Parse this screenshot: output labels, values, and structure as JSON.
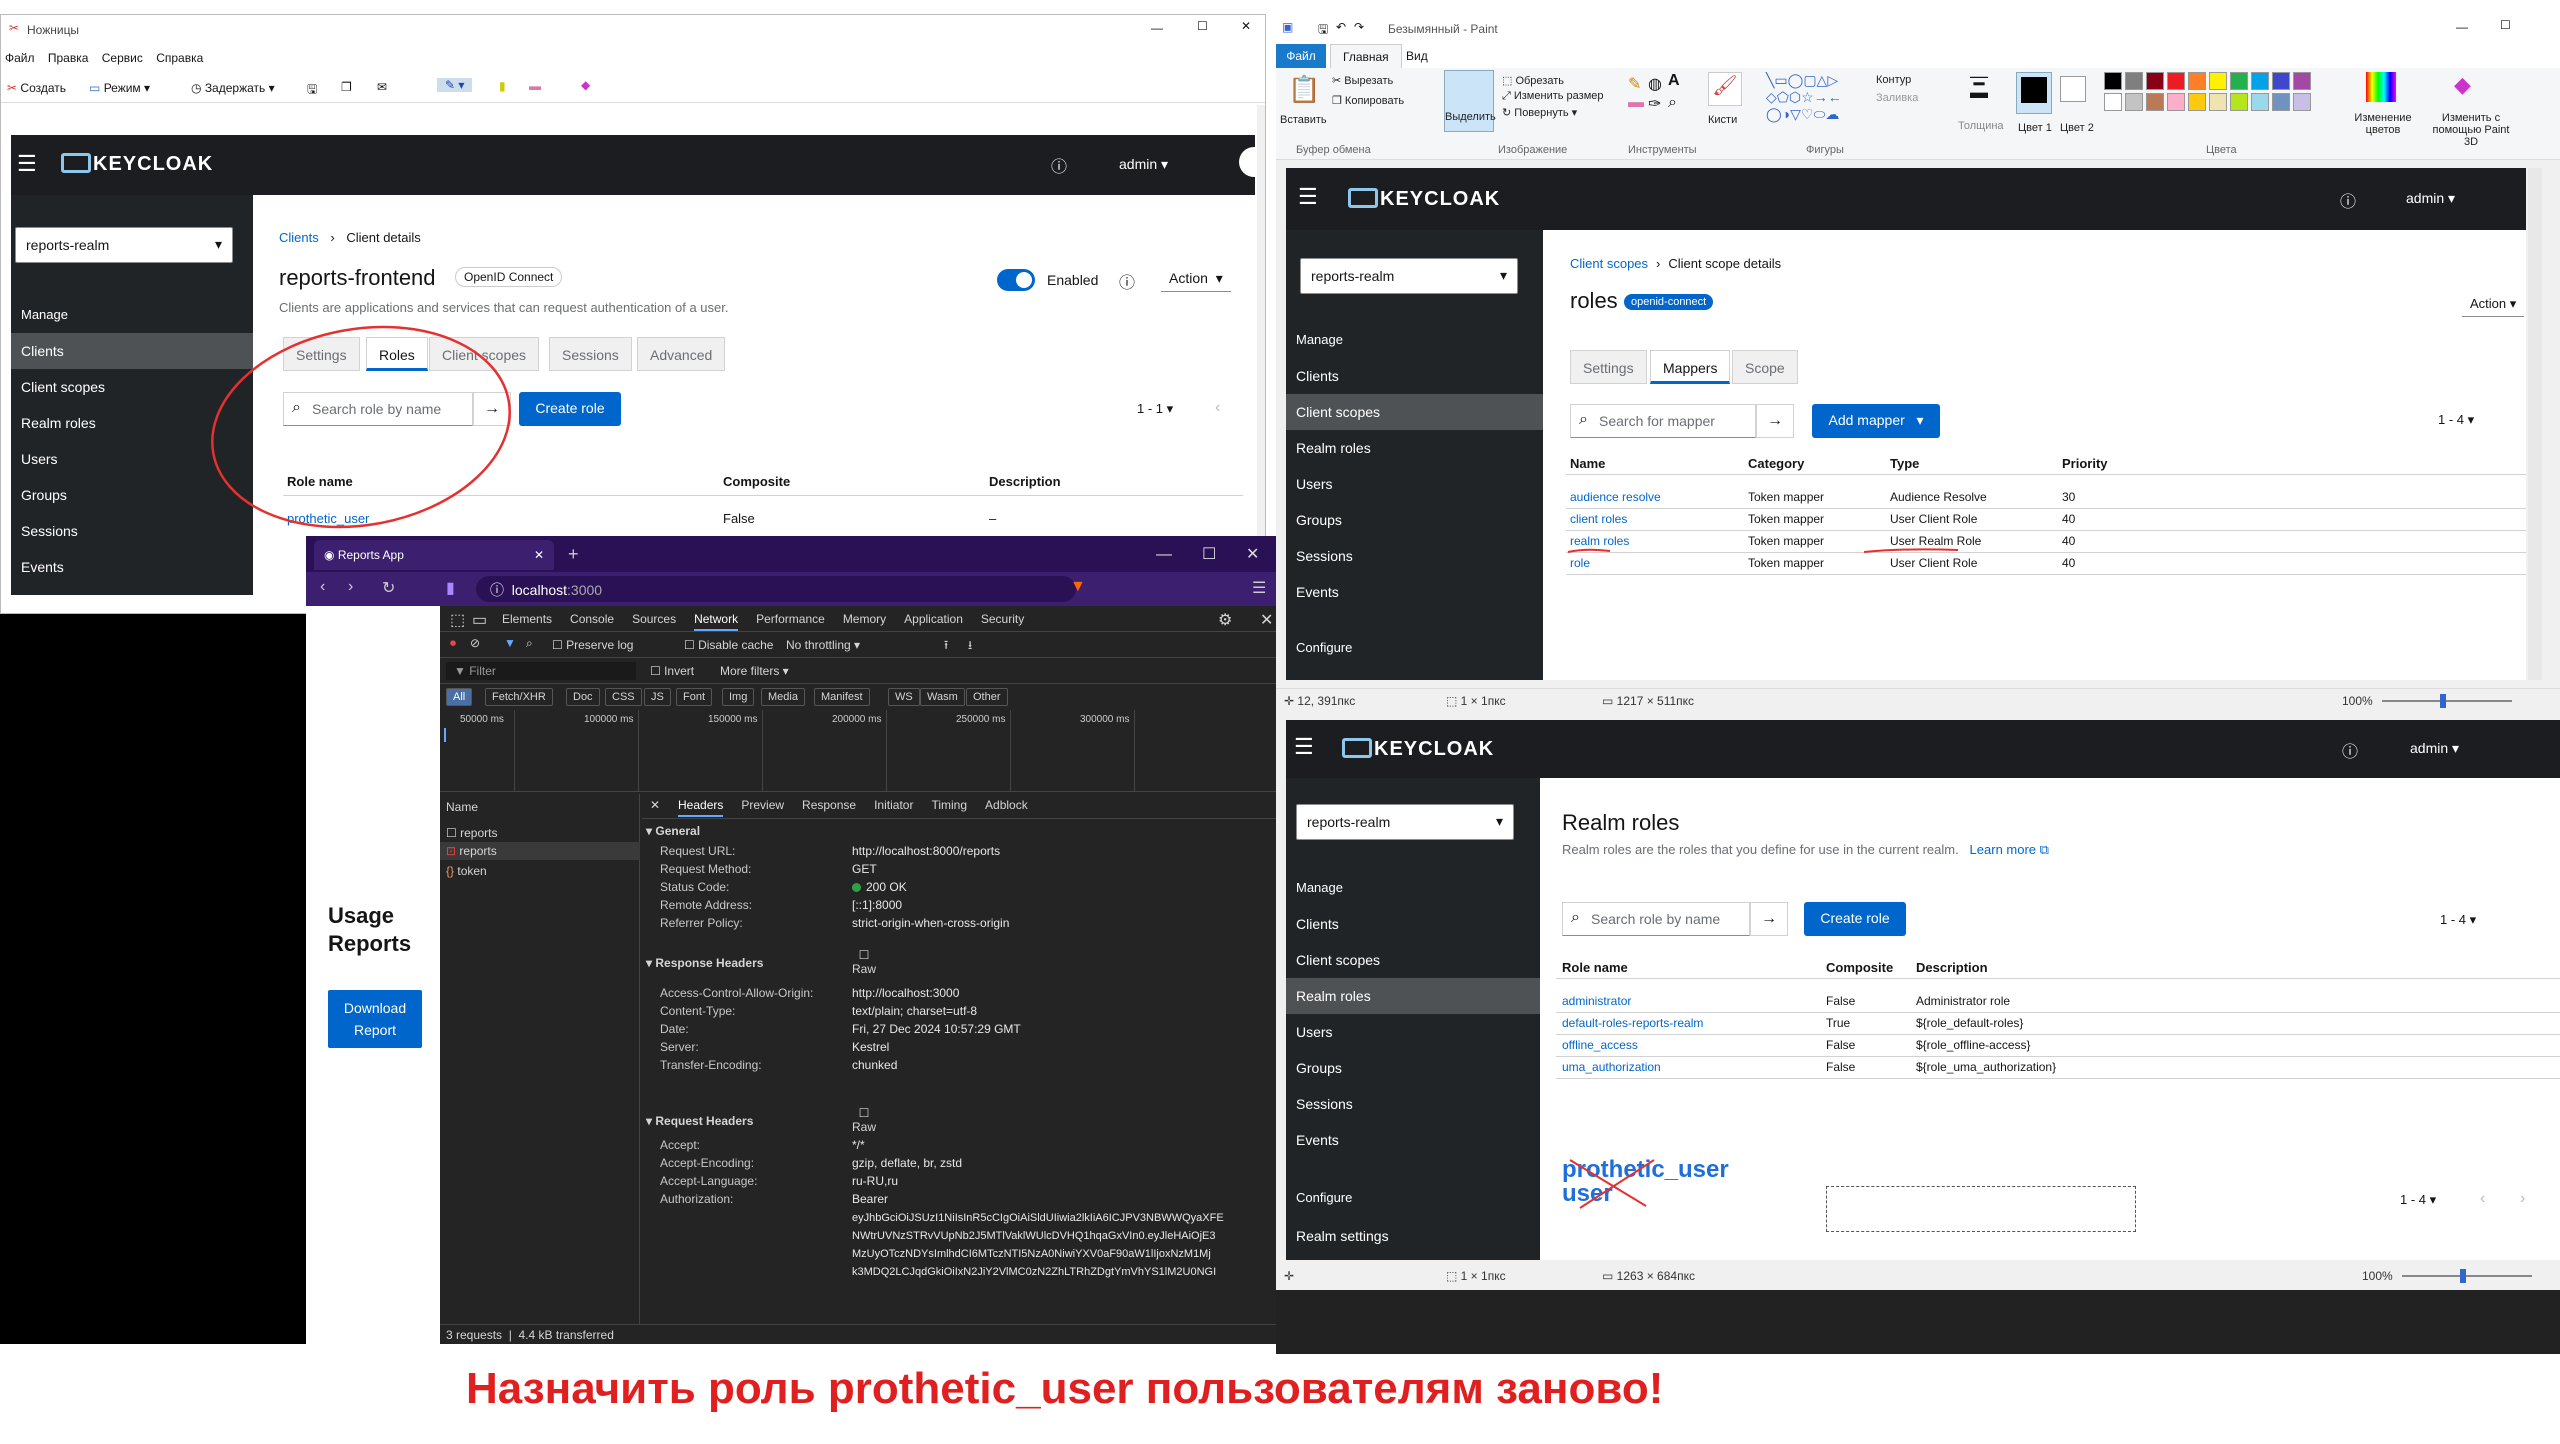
{
  "snip": {
    "title": "Ножницы",
    "menu": [
      "Файл",
      "Правка",
      "Сервис",
      "Справка"
    ],
    "toolbar": [
      "Создать",
      "Режим",
      "Задержать"
    ]
  },
  "kc1": {
    "user": "admin",
    "realm": "reports-realm",
    "side": [
      "Manage",
      "Clients",
      "Client scopes",
      "Realm roles",
      "Users",
      "Groups",
      "Sessions",
      "Events"
    ],
    "bc1": "Clients",
    "bc2": "Client details",
    "title": "reports-frontend",
    "badge": "OpenID Connect",
    "desc": "Clients are applications and services that can request authentication of a user.",
    "enabled": "Enabled",
    "action": "Action",
    "tabs": [
      "Settings",
      "Roles",
      "Client scopes",
      "Sessions",
      "Advanced"
    ],
    "search": "Search role by name",
    "create": "Create role",
    "pager": "1 - 1",
    "cols": [
      "Role name",
      "Composite",
      "Description"
    ],
    "row": [
      "prothetic_user",
      "False",
      "–"
    ]
  },
  "browser": {
    "tab": "Reports App",
    "url_host": "localhost",
    "url_port": ":3000",
    "usage": "Usage Reports",
    "download": "Download Report"
  },
  "devtools": {
    "tabs": [
      "Elements",
      "Console",
      "Sources",
      "Network",
      "Performance",
      "Memory",
      "Application",
      "Security"
    ],
    "filterbar": [
      "Preserve log",
      "Disable cache",
      "No throttling"
    ],
    "filter": "Filter",
    "invert": "Invert",
    "more": "More filters",
    "types": [
      "All",
      "Fetch/XHR",
      "Doc",
      "CSS",
      "JS",
      "Font",
      "Img",
      "Media",
      "Manifest",
      "WS",
      "Wasm",
      "Other"
    ],
    "ticks": [
      "50000 ms",
      "100000 ms",
      "150000 ms",
      "200000 ms",
      "250000 ms",
      "300000 ms"
    ],
    "name_col": "Name",
    "requests": [
      "reports",
      "reports",
      "token"
    ],
    "dtabs": [
      "Headers",
      "Preview",
      "Response",
      "Initiator",
      "Timing",
      "Adblock"
    ],
    "general": "General",
    "general_rows": [
      [
        "Request URL:",
        "http://localhost:8000/reports"
      ],
      [
        "Request Method:",
        "GET"
      ],
      [
        "Status Code:",
        "200 OK"
      ],
      [
        "Remote Address:",
        "[::1]:8000"
      ],
      [
        "Referrer Policy:",
        "strict-origin-when-cross-origin"
      ]
    ],
    "resp": "Response Headers",
    "raw": "Raw",
    "resp_rows": [
      [
        "Access-Control-Allow-Origin:",
        "http://localhost:3000"
      ],
      [
        "Content-Type:",
        "text/plain; charset=utf-8"
      ],
      [
        "Date:",
        "Fri, 27 Dec 2024 10:57:29 GMT"
      ],
      [
        "Server:",
        "Kestrel"
      ],
      [
        "Transfer-Encoding:",
        "chunked"
      ]
    ],
    "req": "Request Headers",
    "req_rows": [
      [
        "Accept:",
        "*/*"
      ],
      [
        "Accept-Encoding:",
        "gzip, deflate, br, zstd"
      ],
      [
        "Accept-Language:",
        "ru-RU,ru"
      ],
      [
        "Authorization:",
        "Bearer"
      ]
    ],
    "token_lines": [
      "eyJhbGciOiJSUzI1NiIsInR5cCIgOiAiSldUIiwia2lkIiA6ICJPV3NBWWQyaXFE",
      "NWtrUVNzSTRvVUpNb2J5MTlVaklWUlcDVHQ1hqaGxVIn0.eyJleHAiOjE3",
      "MzUyOTczNDYsImlhdCI6MTczNTI5NzA0NiwiYXV0aF90aW1lIjoxNzM1Mj",
      "k3MDQ2LCJqdGkiOiIxN2JiY2VlMC0zN2ZhLTRhZDgtYmVhYS1lM2U0NGI"
    ],
    "status": [
      "3 requests",
      "4.4 kB transferred"
    ]
  },
  "paint": {
    "title": "Безымянный - Paint",
    "tabs": [
      "Файл",
      "Главная",
      "Вид"
    ],
    "groups": [
      "Буфер обмена",
      "Изображение",
      "Инструменты",
      "Фигуры",
      "Цвета"
    ],
    "tools": [
      "Вставить",
      "Вырезать",
      "Копировать",
      "Выделить",
      "Обрезать",
      "Изменить размер",
      "Повернуть",
      "Кисти",
      "Контур",
      "Заливка",
      "Толщина",
      "Цвет 1",
      "Цвет 2",
      "Изменение цветов",
      "Изменить с помощью Paint 3D"
    ],
    "status1": [
      "12, 391пкс",
      "1 × 1пкс",
      "1217 × 511пкс",
      "100%"
    ],
    "status2": [
      "1 × 1пкс",
      "1263 × 684пкс",
      "100%"
    ],
    "palette": [
      "#000000",
      "#7f7f7f",
      "#880015",
      "#ed1c24",
      "#ff7f27",
      "#fff200",
      "#22b14c",
      "#00a2e8",
      "#3f48cc",
      "#a349a4",
      "#ffffff",
      "#c3c3c3",
      "#b97a57",
      "#ffaec9",
      "#ffc90e",
      "#efe4b0",
      "#b5e61d",
      "#99d9ea",
      "#7092be",
      "#c8bfe7"
    ]
  },
  "kc2": {
    "user": "admin",
    "realm": "reports-realm",
    "side": [
      "Manage",
      "Clients",
      "Client scopes",
      "Realm roles",
      "Users",
      "Groups",
      "Sessions",
      "Events",
      "Configure"
    ],
    "bc1": "Client scopes",
    "bc2": "Client scope details",
    "title": "roles",
    "badge": "openid-connect",
    "action": "Action",
    "tabs": [
      "Settings",
      "Mappers",
      "Scope"
    ],
    "search": "Search for mapper",
    "add": "Add mapper",
    "pager": "1 - 4",
    "cols": [
      "Name",
      "Category",
      "Type",
      "Priority"
    ],
    "rows": [
      [
        "audience resolve",
        "Token mapper",
        "Audience Resolve",
        "30"
      ],
      [
        "client roles",
        "Token mapper",
        "User Client Role",
        "40"
      ],
      [
        "realm roles",
        "Token mapper",
        "User Realm Role",
        "40"
      ],
      [
        "role",
        "Token mapper",
        "User Client Role",
        "40"
      ]
    ]
  },
  "kc3": {
    "user": "admin",
    "realm": "reports-realm",
    "side": [
      "Manage",
      "Clients",
      "Client scopes",
      "Realm roles",
      "Users",
      "Groups",
      "Sessions",
      "Events",
      "Configure",
      "Realm settings"
    ],
    "title": "Realm roles",
    "desc": "Realm roles are the roles that you define for use in the current realm.",
    "learn": "Learn more",
    "search": "Search role by name",
    "create": "Create role",
    "pager": "1 - 4",
    "cols": [
      "Role name",
      "Composite",
      "Description"
    ],
    "rows": [
      [
        "administrator",
        "False",
        "Administrator role"
      ],
      [
        "default-roles-reports-realm",
        "True",
        "${role_default-roles}"
      ],
      [
        "offline_access",
        "False",
        "${role_offline-access}"
      ],
      [
        "uma_authorization",
        "False",
        "${role_uma_authorization}"
      ]
    ],
    "deleted": "prothetic_user",
    "deleted2": "user",
    "pager2": "1 - 4"
  },
  "note": "Назначить роль prothetic_user пользователям заново!"
}
